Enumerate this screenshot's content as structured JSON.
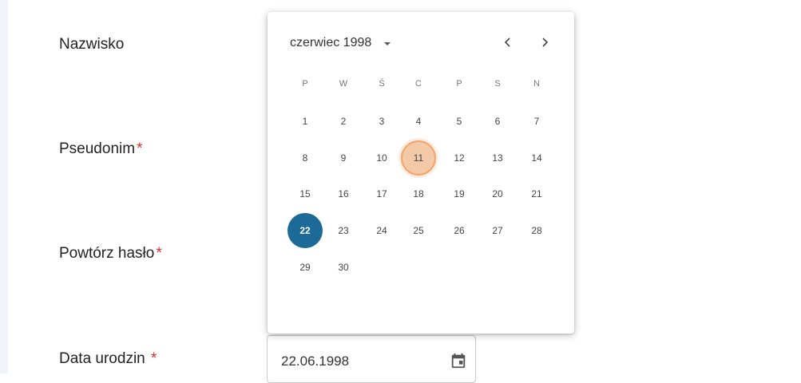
{
  "form": {
    "labels": [
      {
        "text": "Nazwisko",
        "required": false
      },
      {
        "text": "Pseudonim",
        "required": true
      },
      {
        "text": "Powtórz hasło",
        "required": true
      },
      {
        "text": "Data urodzin ",
        "required": true
      }
    ],
    "required_marker": "*",
    "birthdate_value": "22.06.1998"
  },
  "picker": {
    "period_label": "czerwiec 1998",
    "weekdays": [
      "P",
      "W",
      "Ś",
      "C",
      "P",
      "S",
      "N"
    ],
    "weeks": [
      [
        "1",
        "2",
        "3",
        "4",
        "5",
        "6",
        "7"
      ],
      [
        "8",
        "9",
        "10",
        "11",
        "12",
        "13",
        "14"
      ],
      [
        "15",
        "16",
        "17",
        "18",
        "19",
        "20",
        "21"
      ],
      [
        "22",
        "23",
        "24",
        "25",
        "26",
        "27",
        "28"
      ],
      [
        "29",
        "30",
        "",
        "",
        "",
        "",
        ""
      ]
    ],
    "today": "11",
    "selected": "22"
  },
  "icons": {
    "dropdown": "arrow-drop-down-icon",
    "prev": "chevron-left-icon",
    "next": "chevron-right-icon",
    "calendar": "calendar-icon"
  },
  "colors": {
    "selected_bg": "#1b6a97",
    "today_bg": "#f4c9a8",
    "required": "#d32f2f"
  }
}
